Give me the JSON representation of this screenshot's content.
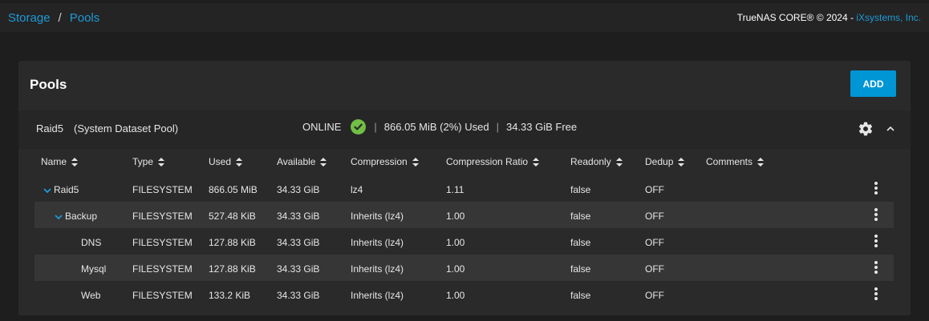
{
  "breadcrumb": {
    "storage": "Storage",
    "sep": "/",
    "pools": "Pools"
  },
  "copyright": {
    "prefix": "TrueNAS CORE® © 2024 - ",
    "brand": "iXsystems, Inc."
  },
  "card": {
    "title": "Pools",
    "add_label": "ADD"
  },
  "pool": {
    "name": "Raid5",
    "sys": "(System Dataset Pool)",
    "status": "ONLINE",
    "sep": "|",
    "used": "866.05 MiB (2%) Used",
    "free": "34.33 GiB Free"
  },
  "columns": [
    "Name",
    "Type",
    "Used",
    "Available",
    "Compression",
    "Compression Ratio",
    "Readonly",
    "Dedup",
    "Comments"
  ],
  "rows": [
    {
      "name": "Raid5",
      "type": "FILESYSTEM",
      "used": "866.05 MiB",
      "available": "34.33 GiB",
      "compression": "lz4",
      "ratio": "1.11",
      "readonly": "false",
      "dedup": "OFF",
      "comments": ""
    },
    {
      "name": "Backup",
      "type": "FILESYSTEM",
      "used": "527.48 KiB",
      "available": "34.33 GiB",
      "compression": "Inherits (lz4)",
      "ratio": "1.00",
      "readonly": "false",
      "dedup": "OFF",
      "comments": ""
    },
    {
      "name": "DNS",
      "type": "FILESYSTEM",
      "used": "127.88 KiB",
      "available": "34.33 GiB",
      "compression": "Inherits (lz4)",
      "ratio": "1.00",
      "readonly": "false",
      "dedup": "OFF",
      "comments": ""
    },
    {
      "name": "Mysql",
      "type": "FILESYSTEM",
      "used": "127.88 KiB",
      "available": "34.33 GiB",
      "compression": "Inherits (lz4)",
      "ratio": "1.00",
      "readonly": "false",
      "dedup": "OFF",
      "comments": ""
    },
    {
      "name": "Web",
      "type": "FILESYSTEM",
      "used": "133.2 KiB",
      "available": "34.33 GiB",
      "compression": "Inherits (lz4)",
      "ratio": "1.00",
      "readonly": "false",
      "dedup": "OFF",
      "comments": ""
    }
  ],
  "icons": {
    "status": "check-circle-icon",
    "settings": "gear-icon",
    "collapse": "chevron-up-icon",
    "expand": "chevron-down-icon",
    "sort": "sort-icon",
    "row_menu": "more-vertical-icon"
  },
  "colors": {
    "accent": "#0095d5",
    "link": "#1e9ad6",
    "status_ok": "#71bf44"
  }
}
